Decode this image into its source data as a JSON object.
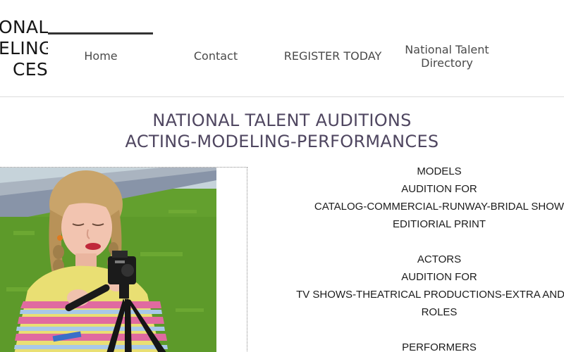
{
  "logo": {
    "lines": [
      "ONAL",
      "ELING",
      "CES"
    ]
  },
  "nav": {
    "home": "Home",
    "contact": "Contact",
    "register": "REGISTER TODAY",
    "directory": "National Talent Directory"
  },
  "title": {
    "line1": "NATIONAL TALENT AUDITIONS",
    "line2": "ACTING-MODELING-PERFORMANCES"
  },
  "info": {
    "models_heading": "MODELS",
    "models_audition": "AUDITION FOR",
    "models_line1": "CATALOG-COMMERCIAL-RUNWAY-BRIDAL SHOW",
    "models_line2": "EDITIORIAL PRINT",
    "actors_heading": "ACTORS",
    "actors_audition": "AUDITION FOR",
    "actors_line1": "TV SHOWS-THEATRICAL PRODUCTIONS-EXTRA AND PR",
    "actors_line2": "ROLES",
    "performers_heading": "PERFORMERS"
  },
  "colors": {
    "title": "#4f4660",
    "nav": "#4a4a4a",
    "grass": "#5f9a2c",
    "sky": "#c9d6de",
    "road": "#8792a5"
  }
}
